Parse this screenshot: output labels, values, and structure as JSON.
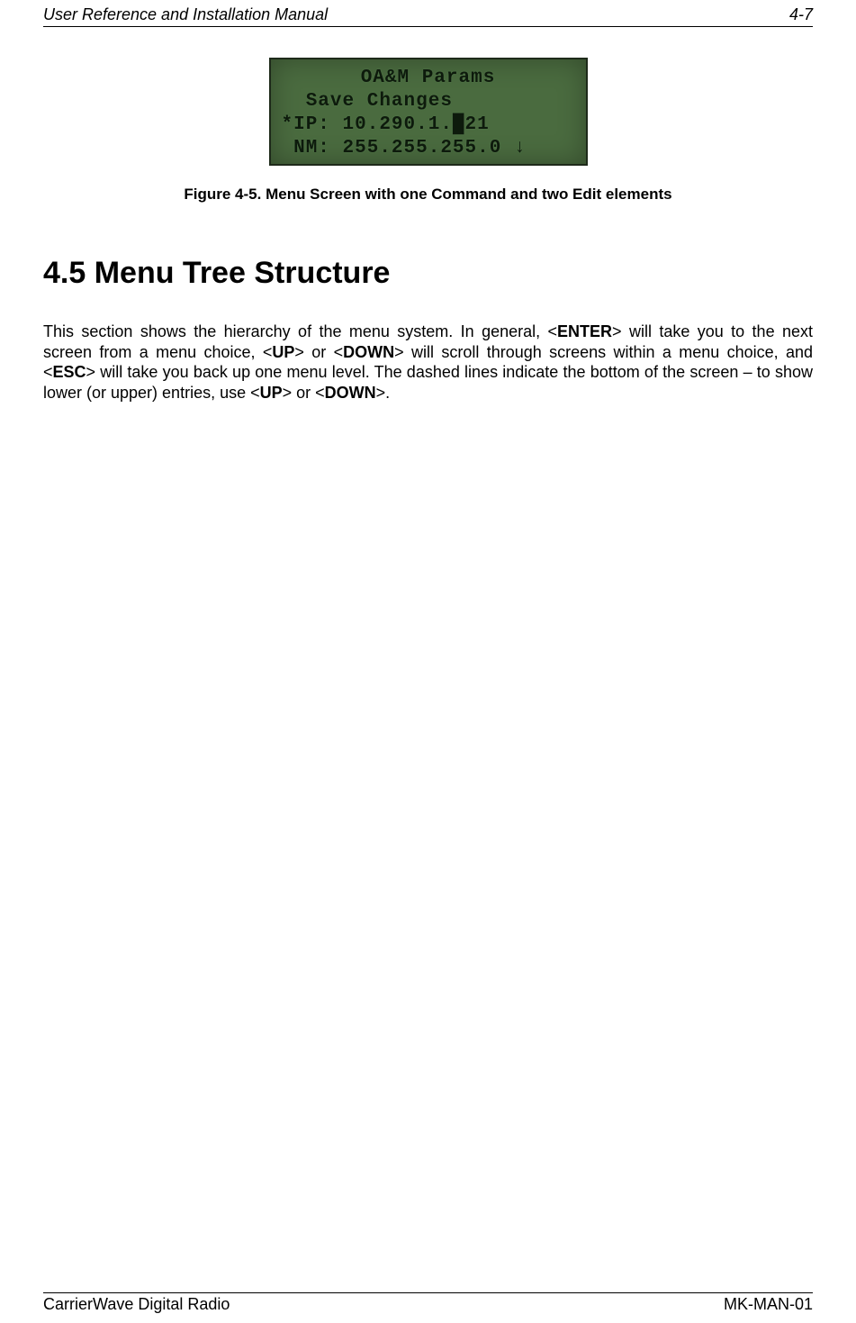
{
  "header": {
    "title": "User Reference and Installation Manual",
    "page_marker": "4-7"
  },
  "lcd": {
    "line1": "OA&M Params",
    "line2": "  Save Changes",
    "line3": "*IP: 10.290.1.█21",
    "line4": " NM: 255.255.255.0 ↓"
  },
  "figure": {
    "label": "Figure 4-5.  Menu Screen with one Command and two Edit elements"
  },
  "section": {
    "heading": "4.5 Menu Tree Structure",
    "para_pre": "This section shows the hierarchy of the menu system.  In general, <",
    "enter": "ENTER",
    "para_mid1": "> will take you to the next screen from a menu choice, <",
    "up": "UP",
    "para_mid2": "> or <",
    "down": "DOWN",
    "para_mid3": "> will scroll through screens within a menu choice, and <",
    "esc": "ESC",
    "para_mid4": "> will take you back up one menu level.   The dashed lines indicate the bottom of the screen – to show lower (or upper) entries, use <",
    "up2": "UP",
    "para_mid5": "> or <",
    "down2": "DOWN",
    "para_end": ">."
  },
  "footer": {
    "left": "CarrierWave Digital Radio",
    "right": "MK-MAN-01"
  }
}
